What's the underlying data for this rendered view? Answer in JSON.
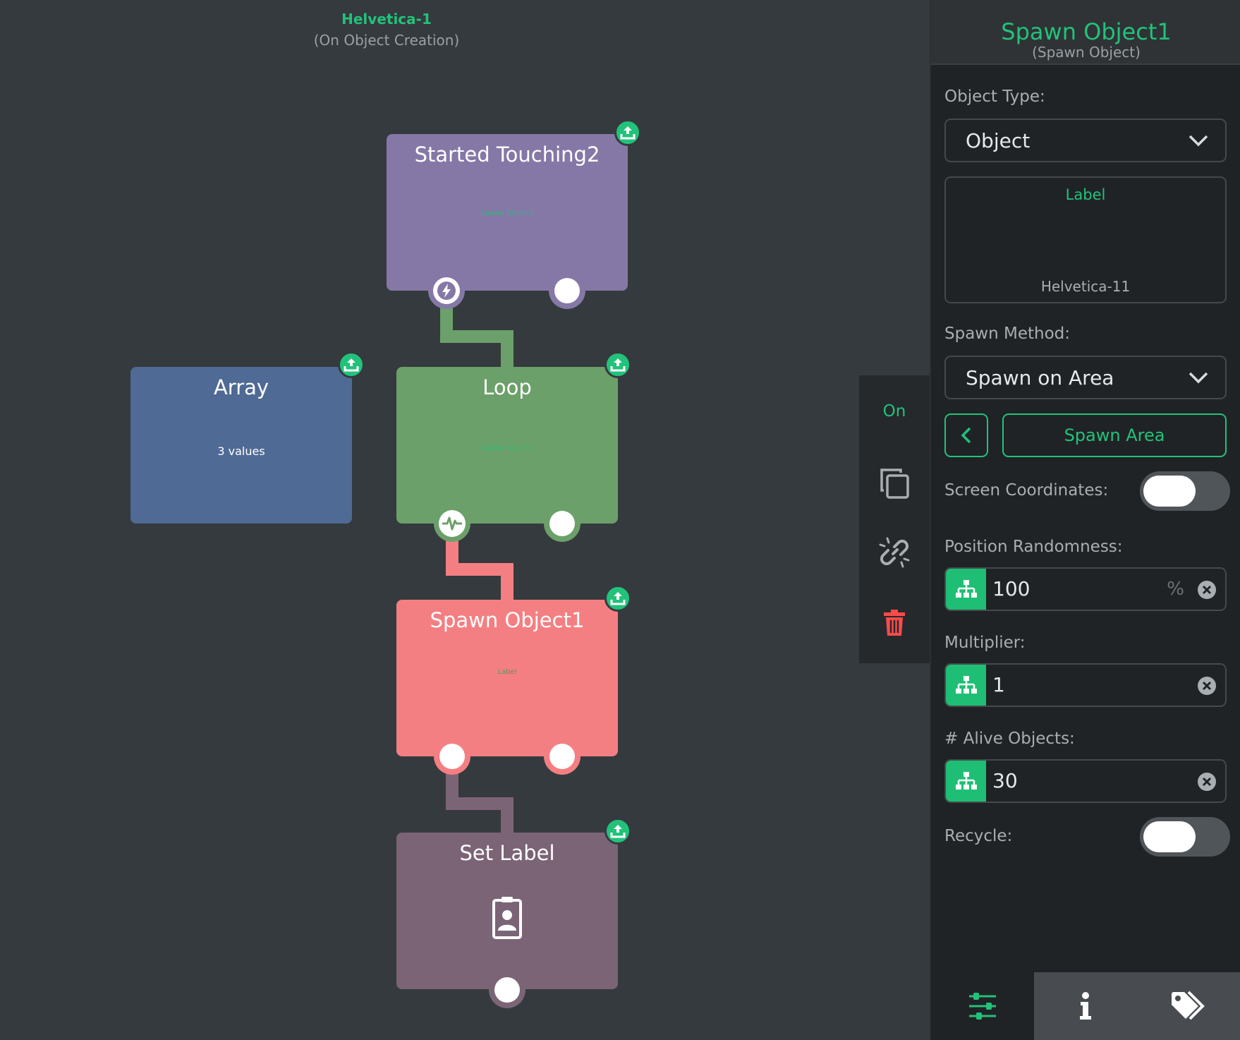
{
  "canvas": {
    "header_title": "Helvetica-1",
    "header_subtitle": "(On Object Creation)",
    "nodes": {
      "started": {
        "title": "Started Touching2",
        "subtitle": "Spawn Object1"
      },
      "array": {
        "title": "Array",
        "info": "3 values"
      },
      "loop": {
        "title": "Loop",
        "subtitle": "Spawn Object1"
      },
      "spawn": {
        "title": "Spawn Object1",
        "subtitle": "Label"
      },
      "setlabel": {
        "title": "Set Label"
      }
    },
    "colors": {
      "started": "#8578a6",
      "array": "#4f6a94",
      "loop": "#6ca06a",
      "spawn": "#f47f82",
      "setlabel": "#7b6476",
      "accent": "#22c27a"
    }
  },
  "toolbar": {
    "state_label": "On",
    "icons": [
      "duplicate-icon",
      "unlink-icon",
      "trash-icon"
    ]
  },
  "panel": {
    "title": "Spawn Object1",
    "subtitle": "(Spawn Object)",
    "object_type_label": "Object Type:",
    "object_type_value": "Object",
    "label_box_title": "Label",
    "label_box_value": "Helvetica-11",
    "spawn_method_label": "Spawn Method:",
    "spawn_method_value": "Spawn on Area",
    "spawn_area_button": "Spawn Area",
    "screen_coordinates_label": "Screen Coordinates:",
    "screen_coordinates_on": false,
    "position_randomness_label": "Position Randomness:",
    "position_randomness_value": "100",
    "position_randomness_unit": "%",
    "multiplier_label": "Multiplier:",
    "multiplier_value": "1",
    "alive_objects_label": "# Alive Objects:",
    "alive_objects_value": "30",
    "recycle_label": "Recycle:",
    "recycle_on": false,
    "tabs": [
      "sliders-icon",
      "info-icon",
      "tags-icon"
    ],
    "active_tab": "sliders-icon"
  }
}
